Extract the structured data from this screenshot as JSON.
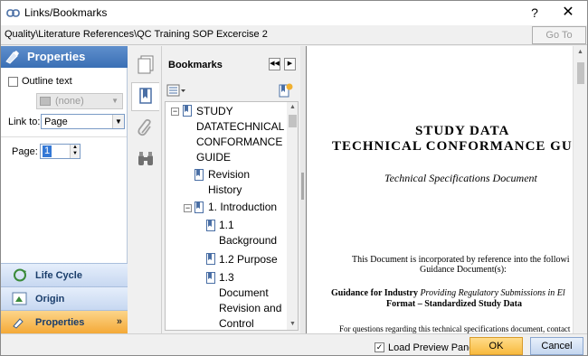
{
  "window": {
    "title": "Links/Bookmarks",
    "help_label": "?",
    "close_label": "✕"
  },
  "pathbar": {
    "path": "Quality\\Literature References\\QC Training SOP Excercise 2",
    "goto_label": "Go To"
  },
  "properties": {
    "header": "Properties",
    "outline_text_label": "Outline text",
    "style_value": "(none)",
    "link_to_label": "Link to:",
    "link_to_value": "Page",
    "page_label": "Page:",
    "page_value": "1"
  },
  "nav": {
    "lifecycle": "Life Cycle",
    "origin": "Origin",
    "properties": "Properties"
  },
  "bookmarks": {
    "title": "Bookmarks",
    "items": [
      {
        "label": "STUDY DATATECHNICAL CONFORMANCE GUIDE"
      },
      {
        "label": "Revision History"
      },
      {
        "label": "1. Introduction"
      },
      {
        "label": "1.1 Background"
      },
      {
        "label": "1.2  Purpose"
      },
      {
        "label": "1.3 Document Revision and Control"
      }
    ]
  },
  "document": {
    "title_line1": "STUDY DATA",
    "title_line2": "TECHNICAL CONFORMANCE GU",
    "subtitle": "Technical Specifications Document",
    "para1": "This Document is incorporated by reference into the followi",
    "para2": "Guidance Document(s):",
    "para3_bold": "Guidance for Industry ",
    "para3_italic": "Providing Regulatory Submissions in El",
    "para4": "Format – Standardized Study Data",
    "para5": "For questions regarding this technical specifications document, contact CI"
  },
  "footer": {
    "load_preview_label": "Load Preview Pane",
    "ok_label": "OK",
    "cancel_label": "Cancel"
  },
  "colors": {
    "accent": "#3a6fb5",
    "ok_button": "#f8b93e",
    "nav_active": "#f4a937"
  },
  "icons": [
    "link-icon",
    "help-icon",
    "close-icon",
    "properties-icon",
    "lifecycle-icon",
    "origin-icon",
    "pages-icon",
    "bookmark-icon",
    "attachment-icon",
    "search-binoculars-icon",
    "options-icon",
    "new-bookmark-icon"
  ]
}
